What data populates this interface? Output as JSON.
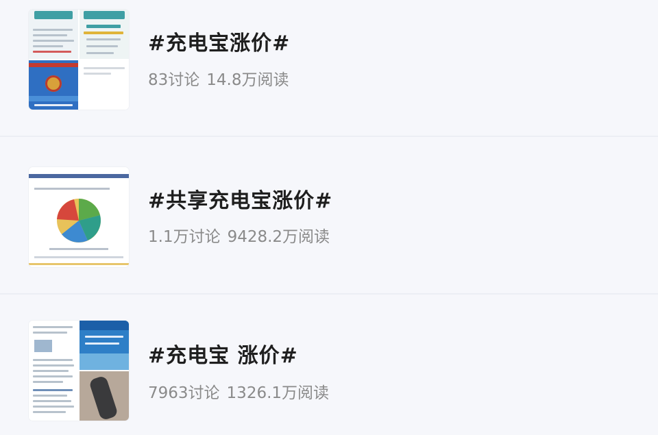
{
  "topics": [
    {
      "title": "#充电宝涨价#",
      "discussions": "83讨论",
      "reads": "14.8万阅读",
      "thumbnail_icon": "screenshot-collage-image"
    },
    {
      "title": "#共享充电宝涨价#",
      "discussions": "1.1万讨论",
      "reads": "9428.2万阅读",
      "thumbnail_icon": "pie-chart-image"
    },
    {
      "title": "#充电宝 涨价#",
      "discussions": "7963讨论",
      "reads": "1326.1万阅读",
      "thumbnail_icon": "photo-collage-image"
    }
  ],
  "colors": {
    "background": "#f6f7fb",
    "title": "#1f1f1f",
    "stats": "#8a8a8a",
    "divider": "#eceef4"
  }
}
